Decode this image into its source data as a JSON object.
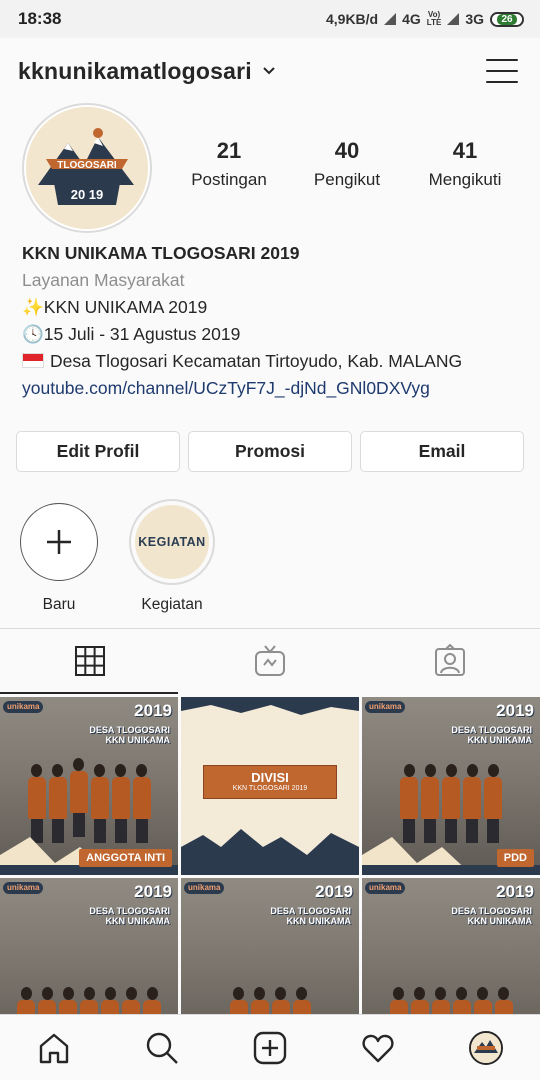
{
  "status_bar": {
    "time": "18:38",
    "net_speed": "4,9KB/d",
    "network1": "4G",
    "volte_top": "Vo)",
    "volte_bottom": "LTE",
    "network2": "3G",
    "battery": "26"
  },
  "header": {
    "username": "kknunikamatlogosari"
  },
  "avatar_logo": {
    "title": "TLOGOSARI",
    "year": "20 19"
  },
  "stats": [
    {
      "value": "21",
      "label": "Postingan"
    },
    {
      "value": "40",
      "label": "Pengikut"
    },
    {
      "value": "41",
      "label": "Mengikuti"
    }
  ],
  "bio": {
    "name": "KKN UNIKAMA TLOGOSARI 2019",
    "category": "Layanan Masyarakat",
    "line1_emoji": "✨",
    "line1": "KKN UNIKAMA 2019",
    "line2_emoji": "🕓",
    "line2": "15 Juli - 31 Agustus 2019",
    "line3": "Desa Tlogosari Kecamatan Tirtoyudo, Kab. MALANG",
    "link": "youtube.com/channel/UCzTyF7J_-djNd_GNl0DXVyg"
  },
  "buttons": {
    "edit": "Edit Profil",
    "promo": "Promosi",
    "email": "Email"
  },
  "highlights": [
    {
      "label": "Baru"
    },
    {
      "label": "Kegiatan",
      "cover_text": "KEGIATAN"
    }
  ],
  "grid": [
    {
      "brand": "unikama",
      "year": "2019",
      "desa": "DESA TLOGOSARI",
      "desa_sub": "KKN UNIKAMA",
      "caption": "ANGGOTA INTI"
    },
    {
      "title": "DIVISI",
      "subtitle": "KKN TLOGOSARI 2019"
    },
    {
      "brand": "unikama",
      "year": "2019",
      "desa": "DESA TLOGOSARI",
      "desa_sub": "KKN UNIKAMA",
      "caption": "PDD"
    },
    {
      "brand": "unikama",
      "year": "2019",
      "desa": "DESA TLOGOSARI",
      "desa_sub": "KKN UNIKAMA"
    },
    {
      "brand": "unikama",
      "year": "2019",
      "desa": "DESA TLOGOSARI",
      "desa_sub": "KKN UNIKAMA"
    },
    {
      "brand": "unikama",
      "year": "2019",
      "desa": "DESA TLOGOSARI",
      "desa_sub": "KKN UNIKAMA"
    }
  ],
  "colors": {
    "link": "#1e3a6e",
    "accent_orange": "#c0662f",
    "navy": "#2c3a4e",
    "battery_green": "#2e7d32"
  },
  "icons": {
    "tabs": [
      "grid-icon",
      "igtv-icon",
      "tagged-icon"
    ],
    "nav": [
      "home-icon",
      "search-icon",
      "add-post-icon",
      "heart-icon",
      "profile-avatar"
    ]
  }
}
